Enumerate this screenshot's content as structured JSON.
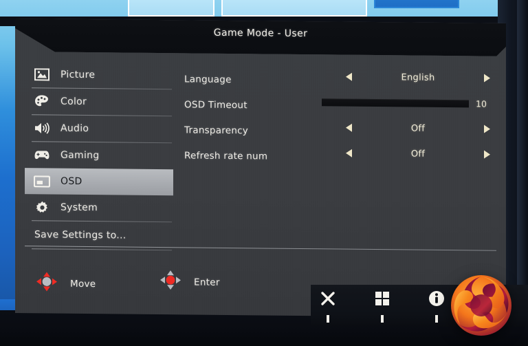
{
  "window": {
    "title": "Game Mode - User"
  },
  "sidebar": {
    "items": [
      {
        "label": "Picture",
        "icon": "picture-icon",
        "active": false
      },
      {
        "label": "Color",
        "icon": "palette-icon",
        "active": false
      },
      {
        "label": "Audio",
        "icon": "speaker-icon",
        "active": false
      },
      {
        "label": "Gaming",
        "icon": "gamepad-icon",
        "active": false
      },
      {
        "label": "OSD",
        "icon": "osd-icon",
        "active": true
      },
      {
        "label": "System",
        "icon": "gear-icon",
        "active": false
      }
    ],
    "save_settings_label": "Save Settings to..."
  },
  "settings": {
    "rows": [
      {
        "label": "Language",
        "type": "selector",
        "value": "English"
      },
      {
        "label": "OSD Timeout",
        "type": "slider",
        "value": "10",
        "fill_percent": 78
      },
      {
        "label": "Transparency",
        "type": "selector",
        "value": "Off"
      },
      {
        "label": "Refresh rate num",
        "type": "selector",
        "value": "Off"
      }
    ]
  },
  "footer": {
    "move_label": "Move",
    "enter_label": "Enter"
  },
  "hardware_buttons": [
    {
      "icon": "close-x-icon",
      "name": "exit-button"
    },
    {
      "icon": "grid-squares-icon",
      "name": "menu-button"
    },
    {
      "icon": "info-circle-icon",
      "name": "info-button"
    },
    {
      "icon": "dpad-navigate-icon",
      "name": "navigate-button"
    }
  ],
  "branding": {
    "logo": "kitguru-swirl-logo"
  },
  "colors": {
    "panel_bg": "#3a3d41",
    "titlebar_bg": "#0e1014",
    "highlight": "#aeb1b6",
    "value_text": "#f0ecd9",
    "arrow": "#efe7c8",
    "desktop_blue": "#2f8fdc",
    "logo_orange": "#f7931e",
    "logo_red": "#c9223f",
    "dpad_red": "#ee2b24"
  }
}
